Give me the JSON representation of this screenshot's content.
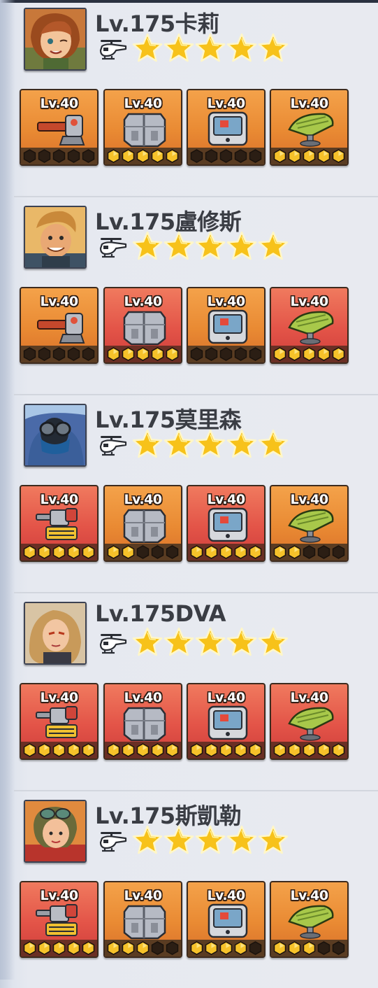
{
  "heroes": [
    {
      "name": "Lv.175卡莉",
      "portrait": "portrait-kali",
      "stars": 5,
      "unit_type": "helicopter-icon",
      "gear": [
        {
          "level": "Lv.40",
          "item": "cannon",
          "rarity": "orange",
          "filled": 0
        },
        {
          "level": "Lv.40",
          "item": "armor",
          "rarity": "orange",
          "filled": 5
        },
        {
          "level": "Lv.40",
          "item": "chip",
          "rarity": "orange",
          "filled": 0
        },
        {
          "level": "Lv.40",
          "item": "radar",
          "rarity": "orange",
          "filled": 5
        }
      ]
    },
    {
      "name": "Lv.175盧修斯",
      "portrait": "portrait-lucius",
      "stars": 5,
      "unit_type": "helicopter-icon",
      "gear": [
        {
          "level": "Lv.40",
          "item": "cannon",
          "rarity": "orange",
          "filled": 0
        },
        {
          "level": "Lv.40",
          "item": "armor",
          "rarity": "red",
          "filled": 5
        },
        {
          "level": "Lv.40",
          "item": "chip",
          "rarity": "orange",
          "filled": 0
        },
        {
          "level": "Lv.40",
          "item": "radar",
          "rarity": "red",
          "filled": 5
        }
      ]
    },
    {
      "name": "Lv.175莫里森",
      "portrait": "portrait-morrison",
      "stars": 5,
      "unit_type": "helicopter-icon",
      "gear": [
        {
          "level": "Lv.40",
          "item": "turret",
          "rarity": "red",
          "filled": 5
        },
        {
          "level": "Lv.40",
          "item": "armor",
          "rarity": "orange",
          "filled": 2
        },
        {
          "level": "Lv.40",
          "item": "chip",
          "rarity": "red",
          "filled": 5
        },
        {
          "level": "Lv.40",
          "item": "radar",
          "rarity": "orange",
          "filled": 2
        }
      ]
    },
    {
      "name": "Lv.175DVA",
      "portrait": "portrait-dva",
      "stars": 5,
      "unit_type": "helicopter-icon",
      "gear": [
        {
          "level": "Lv.40",
          "item": "turret",
          "rarity": "red",
          "filled": 5
        },
        {
          "level": "Lv.40",
          "item": "armor",
          "rarity": "red",
          "filled": 5
        },
        {
          "level": "Lv.40",
          "item": "chip",
          "rarity": "red",
          "filled": 5
        },
        {
          "level": "Lv.40",
          "item": "radar",
          "rarity": "red",
          "filled": 5
        }
      ]
    },
    {
      "name": "Lv.175斯凱勒",
      "portrait": "portrait-skyler",
      "stars": 5,
      "unit_type": "helicopter-icon",
      "gear": [
        {
          "level": "Lv.40",
          "item": "turret",
          "rarity": "red",
          "filled": 5
        },
        {
          "level": "Lv.40",
          "item": "armor",
          "rarity": "orange",
          "filled": 3
        },
        {
          "level": "Lv.40",
          "item": "chip",
          "rarity": "orange",
          "filled": 4
        },
        {
          "level": "Lv.40",
          "item": "radar",
          "rarity": "orange",
          "filled": 3
        }
      ]
    }
  ],
  "colors": {
    "orange_card": "#e98a33",
    "red_card": "#e35448",
    "star_gold": "#f7c21a",
    "hex_gold": "#f6c22a",
    "hex_empty": "#2b1e14",
    "name_text": "#3a3d44"
  }
}
